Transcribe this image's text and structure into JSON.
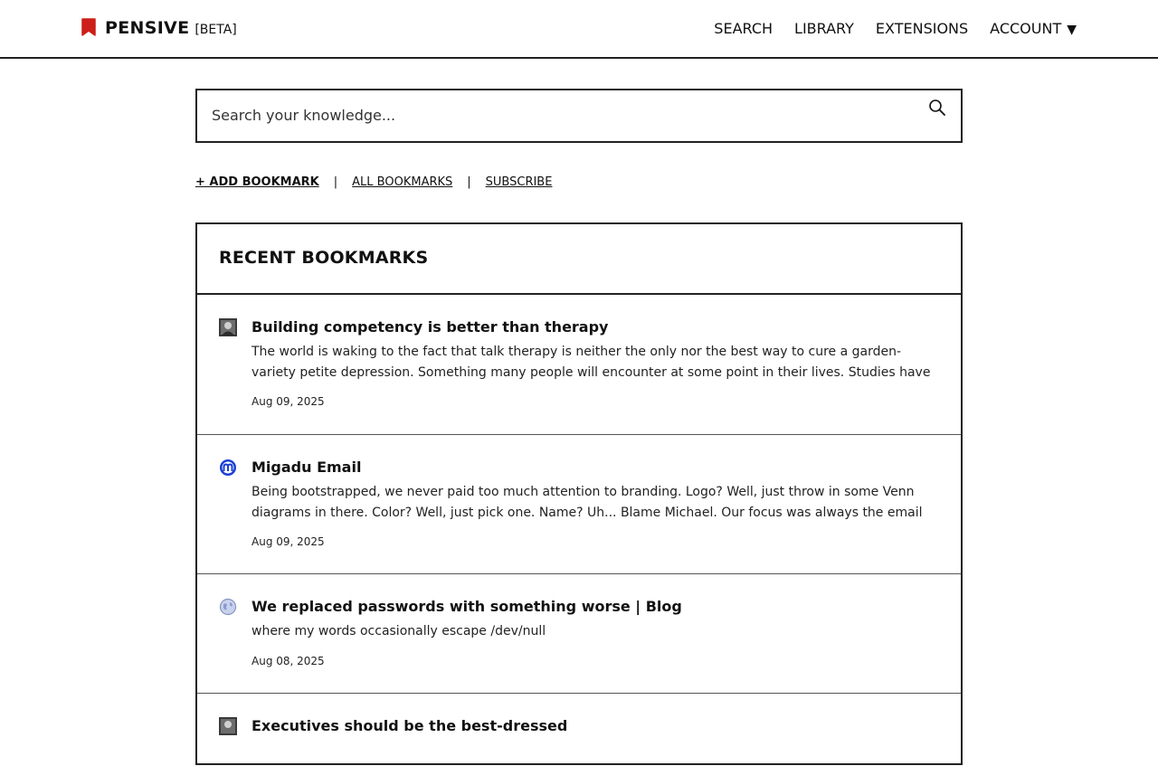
{
  "header": {
    "brand": "PENSIVE",
    "beta": "[BETA]",
    "brand_color": "#cc1f1a",
    "nav": [
      {
        "label": "SEARCH"
      },
      {
        "label": "LIBRARY"
      },
      {
        "label": "EXTENSIONS"
      },
      {
        "label": "ACCOUNT",
        "caret": "▼"
      }
    ]
  },
  "search": {
    "placeholder": "Search your knowledge...",
    "value": "",
    "icon": "search-icon"
  },
  "actions": {
    "add": "+ ADD BOOKMARK",
    "separator": "|",
    "all": "ALL BOOKMARKS",
    "subscribe": "SUBSCRIBE"
  },
  "recent": {
    "title": "RECENT BOOKMARKS",
    "items": [
      {
        "icon": "avatar-icon",
        "title": "Building competency is better than therapy",
        "desc": "The world is waking to the fact that talk therapy is neither the only nor the best way to cure a garden-variety petite depression. Something many people will encounter at some point in their lives. Studies have shown that exercise, for...",
        "date": "Aug 09, 2025"
      },
      {
        "icon": "migadu-logo-icon",
        "title": "Migadu Email",
        "desc": "Being bootstrapped, we never paid too much attention to branding. Logo? Well, just throw in some Venn diagrams in there. Color? Well, just pick one. Name? Uh... Blame Michael. Our focus was always the email service. Our team is of...",
        "date": "Aug 09, 2025"
      },
      {
        "icon": "globe-icon",
        "title": "We replaced passwords with something worse | Blog",
        "desc": "where my words occasionally escape /dev/null",
        "date": "Aug 08, 2025"
      },
      {
        "icon": "avatar-icon",
        "title": "Executives should be the best-dressed",
        "desc": "",
        "date": ""
      }
    ]
  }
}
